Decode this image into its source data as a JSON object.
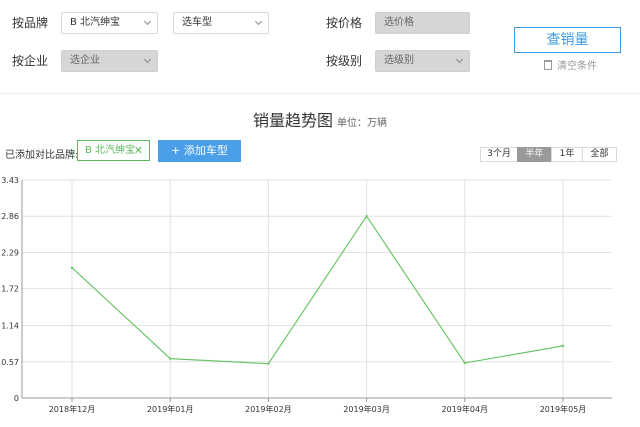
{
  "filters": {
    "brand_label": "按品牌",
    "brand_value": "B 北汽绅宝",
    "model_placeholder": "选车型",
    "price_label": "按价格",
    "price_placeholder": "选价格",
    "company_label": "按企业",
    "company_placeholder": "选企业",
    "level_label": "按级别",
    "level_placeholder": "选级别"
  },
  "actions": {
    "query_label": "查销量",
    "clear_label": "清空条件"
  },
  "compare": {
    "label": "已添加对比品牌:",
    "brand_chip": "B 北汽绅宝",
    "add_label": "+ 添加车型"
  },
  "ranges": [
    "3个月",
    "半年",
    "1年",
    "全部"
  ],
  "active_range": "半年",
  "colors": {
    "accent": "#3d9be0",
    "line": "#6cc56c",
    "chip": "#5cb85c"
  },
  "chart_data": {
    "type": "line",
    "title": "销量趋势图",
    "unit": "单位：万辆",
    "categories": [
      "2018年12月",
      "2019年01月",
      "2019年02月",
      "2019年03月",
      "2019年04月",
      "2019年05月"
    ],
    "series": [
      {
        "values": [
          2.05,
          0.62,
          0.54,
          2.86,
          0.55,
          0.82
        ]
      }
    ],
    "yticks": [
      "0",
      "0.57",
      "1.14",
      "1.72",
      "2.29",
      "2.86",
      "3.43"
    ],
    "ylim": [
      0,
      3.43
    ],
    "grid": true
  }
}
